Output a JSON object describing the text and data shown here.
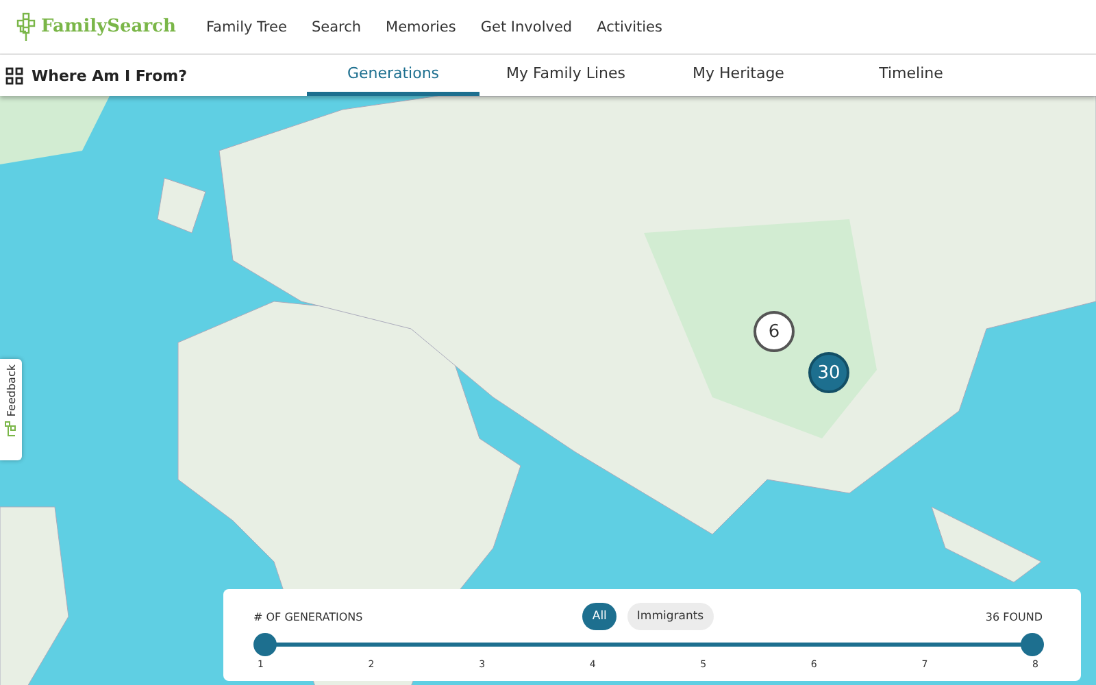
{
  "header": {
    "logo": "FamilySearch",
    "nav": [
      {
        "label": "Family Tree"
      },
      {
        "label": "Search"
      },
      {
        "label": "Memories"
      },
      {
        "label": "Get Involved"
      },
      {
        "label": "Activities"
      }
    ]
  },
  "subnav": {
    "title": "Where Am I From?",
    "tabs": [
      {
        "label": "Generations",
        "selected": true
      },
      {
        "label": "My Family Lines",
        "selected": false
      },
      {
        "label": "My Heritage",
        "selected": false
      },
      {
        "label": "Timeline",
        "selected": false
      }
    ]
  },
  "map": {
    "clusters": [
      {
        "count": "6",
        "selected": false
      },
      {
        "count": "30",
        "selected": true
      }
    ]
  },
  "feedback": {
    "label": "Feedback"
  },
  "panel": {
    "heading": "# OF GENERATIONS",
    "filters": [
      {
        "label": "All",
        "selected": true
      },
      {
        "label": "Immigrants",
        "selected": false
      }
    ],
    "found": "36 FOUND",
    "slider": {
      "thumbs": [
        {
          "level": 0
        },
        {
          "level": 1
        }
      ],
      "ticks": [
        "1",
        "2",
        "3",
        "4",
        "5",
        "6",
        "7",
        "8"
      ]
    }
  }
}
